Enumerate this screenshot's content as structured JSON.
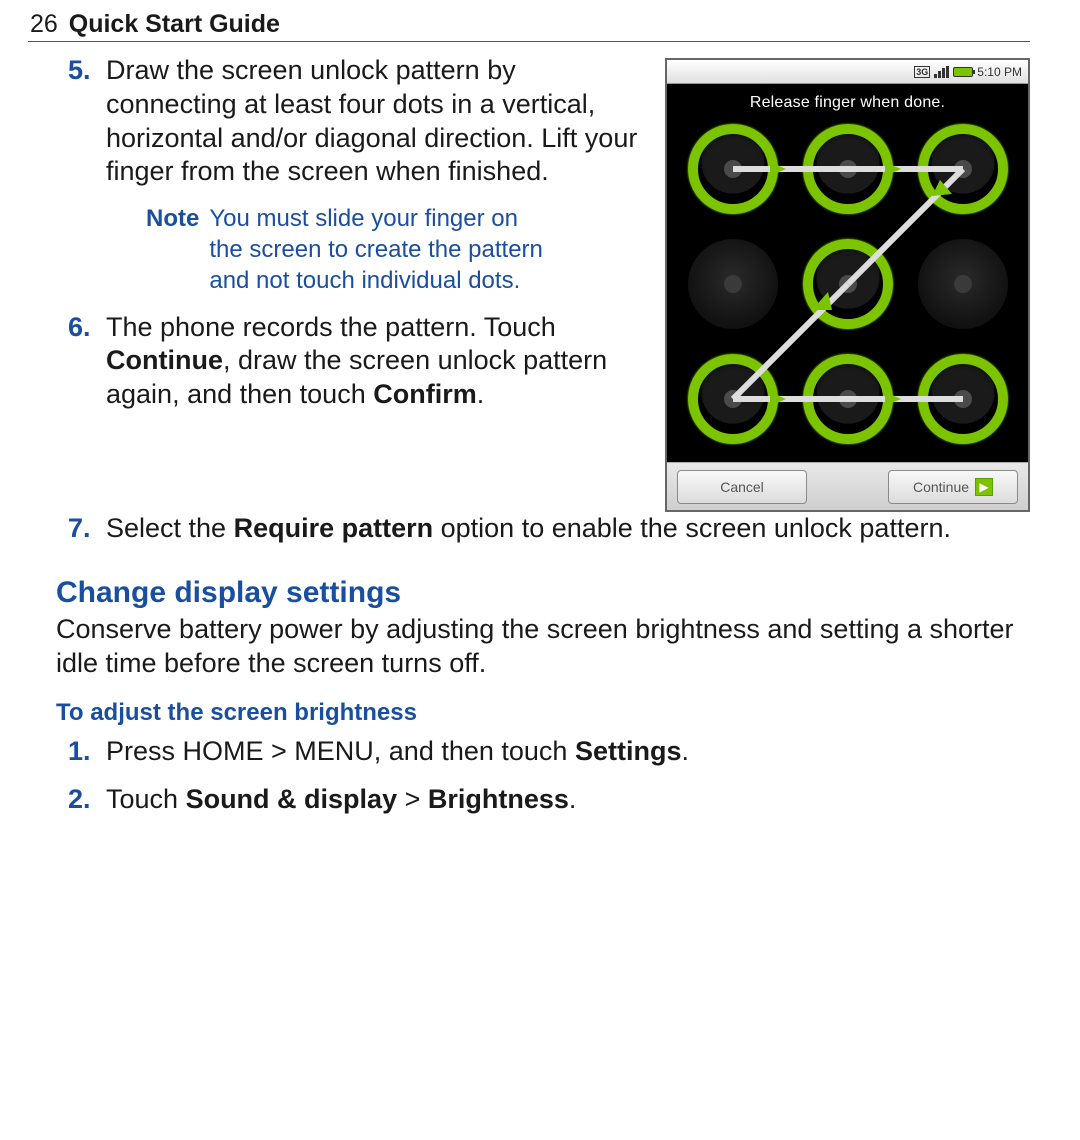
{
  "header": {
    "page_number": "26",
    "title": "Quick Start Guide"
  },
  "steps_a": [
    {
      "num": "5.",
      "text": "Draw the screen unlock pattern by connecting at least four dots in a vertical, horizontal and/or diagonal direction. Lift your finger from the screen when finished."
    }
  ],
  "note": {
    "label": "Note",
    "text": "You must slide your finger on the screen to create the pattern and not touch individual dots."
  },
  "steps_b": [
    {
      "num": "6.",
      "pre": "The phone records the pattern. Touch ",
      "b1": "Continue",
      "mid": ", draw the screen unlock pattern again, and then touch ",
      "b2": "Confirm",
      "post": "."
    }
  ],
  "steps_c": [
    {
      "num": "7.",
      "pre": "Select the ",
      "b1": "Require pattern",
      "post": " option to enable the screen unlock pattern."
    }
  ],
  "section2": {
    "heading": "Change display settings",
    "intro": "Conserve battery power by adjusting the screen brightness and setting a shorter idle time before the screen turns off.",
    "sub": "To adjust the screen brightness",
    "steps": [
      {
        "num": "1.",
        "pre": "Press HOME > MENU, and then touch ",
        "b1": "Settings",
        "post": "."
      },
      {
        "num": "2.",
        "pre": "Touch ",
        "b1": "Sound & display",
        "mid": " > ",
        "b2": "Brightness",
        "post": "."
      }
    ]
  },
  "phone": {
    "time": "5:10 PM",
    "instruction": "Release finger when done.",
    "cancel": "Cancel",
    "continue": "Continue",
    "pattern_active": [
      0,
      1,
      2,
      4,
      6,
      7,
      8
    ],
    "pattern_sequence": [
      0,
      1,
      2,
      4,
      6,
      7,
      8
    ]
  }
}
